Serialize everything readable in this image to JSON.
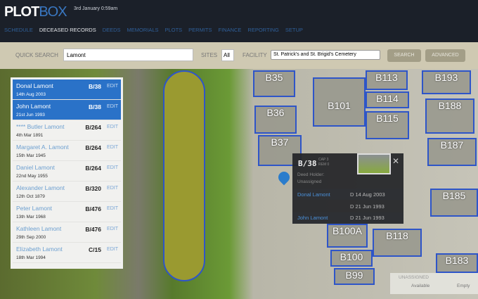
{
  "header": {
    "logo": "PLOTBOX",
    "date": "3rd January 0:59am"
  },
  "nav": [
    "SCHEDULE",
    "DECEASED RECORDS",
    "DEEDS",
    "MEMORIALS",
    "PLOTS",
    "PERMITS",
    "FINANCE",
    "REPORTING",
    "SETUP"
  ],
  "search": {
    "label": "QUICK SEARCH",
    "value": "Lamont",
    "sites_label": "SITES",
    "sites_value": "All",
    "facility_label": "FACILITY",
    "facility_value": "St. Patrick's and St. Brigid's Cemetery",
    "search_btn": "SEARCH",
    "advanced_btn": "ADVANCED"
  },
  "results": [
    {
      "name": "Donal Lamont",
      "date": "14th Aug 2003",
      "plot": "B/38",
      "edit": "EDIT",
      "selected": true
    },
    {
      "name": "John Lamont",
      "date": "21st Jun 1993",
      "plot": "B/38",
      "edit": "EDIT",
      "selected": true
    },
    {
      "name": "**** Butler Lamont",
      "date": "4th Mar 1891",
      "plot": "B/264",
      "edit": "EDIT"
    },
    {
      "name": "Margaret A. Lamont",
      "date": "15th Mar 1945",
      "plot": "B/264",
      "edit": "EDIT"
    },
    {
      "name": "Daniel Lamont",
      "date": "22nd May 1955",
      "plot": "B/264",
      "edit": "EDIT"
    },
    {
      "name": "Alexander Lamont",
      "date": "12th Oct 1879",
      "plot": "B/320",
      "edit": "EDIT"
    },
    {
      "name": "Peter Lamont",
      "date": "13th Mar 1968",
      "plot": "B/476",
      "edit": "EDIT"
    },
    {
      "name": "Kathleen Lamont",
      "date": "29th Sep 2000",
      "plot": "B/476",
      "edit": "EDIT"
    },
    {
      "name": "Elizabeth Lamont",
      "date": "18th Mar 1994",
      "plot": "C/15",
      "edit": "EDIT"
    }
  ],
  "popup": {
    "plot": "B/38",
    "cap": "CAP 3",
    "rem": "REM 0",
    "deed_label": "Deed Holder:",
    "deed_value": "Unassigned",
    "rows": [
      {
        "name": "Donal Lamont",
        "date": "D 14 Aug 2003"
      },
      {
        "name": "",
        "date": "D 21 Jun 1993"
      },
      {
        "name": "John Lamont",
        "date": "D 21 Jun 1993"
      }
    ]
  },
  "map_plots": [
    "B35",
    "B36",
    "B37",
    "B101",
    "B113",
    "B114",
    "B115",
    "B188",
    "B187",
    "B185",
    "B100A",
    "B100",
    "B99",
    "B118",
    "B183",
    "B193"
  ],
  "legend": {
    "title": "UNASSIGNED",
    "items": [
      "Available",
      "Empty"
    ]
  }
}
